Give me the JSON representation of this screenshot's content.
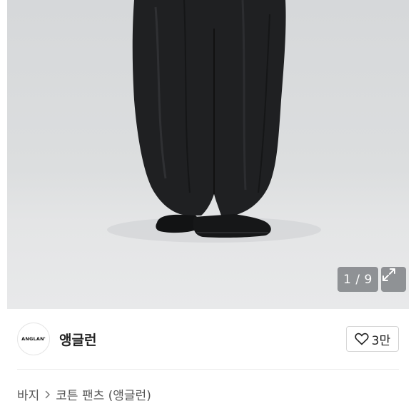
{
  "gallery": {
    "counter_text": "1 / 9",
    "current_index": 1,
    "total": 9,
    "expand_icon": "expand-icon"
  },
  "seller": {
    "avatar_text": "ANGLAN'",
    "name": "앵글런"
  },
  "like": {
    "icon": "heart-outline-icon",
    "count": "3만"
  },
  "breadcrumb": {
    "category": "바지",
    "separator_icon": "chevron-right-icon",
    "product": "코튼 팬츠 (앵글런)"
  },
  "colors": {
    "background": "#ffffff",
    "photo_backdrop": "#dcdedf",
    "overlay_button": "#6e7074"
  }
}
